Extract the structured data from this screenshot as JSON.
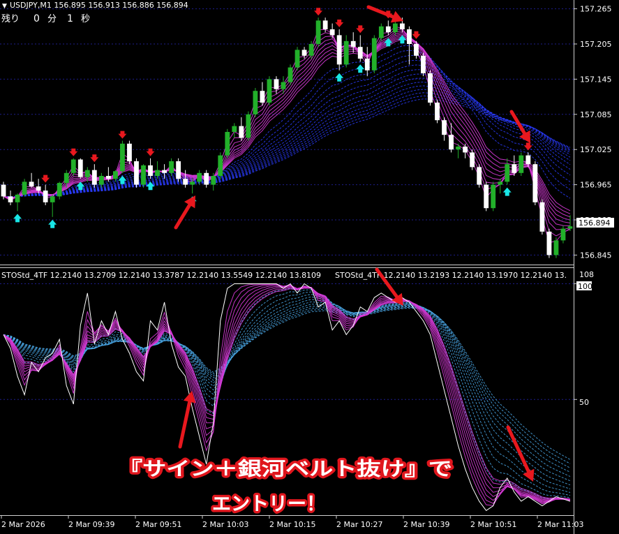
{
  "header": {
    "symbol_line": "USDJPY,M1  156.895 156.913 156.886 156.894",
    "timer_label": "残り",
    "timer_min": "0",
    "timer_min_unit": "分",
    "timer_sec": "1",
    "timer_sec_unit": "秒"
  },
  "indicator": {
    "label_left": "STOStd_4TF 12.2140 13.2709 12.2140 13.3787 12.2140 13.5549 12.2140 13.8109",
    "label_right": "STOStd_4TF 12.2140 13.2193 12.2140 13.1970 12.2140 13.",
    "top_value": "108",
    "level_100": "100",
    "level_50": "50"
  },
  "caption": {
    "line1": "『サイン＋銀河ベルト抜け』で",
    "line2": "エントリー！"
  },
  "colors": {
    "bull": "#22b02a",
    "bear": "#ffffff",
    "ma_belt": "#d83ad8",
    "slow_belt": "#2a3cff",
    "sto_belt": "#4aa8e8",
    "arrow_red": "#e8181e",
    "arrow_cyan": "#19e6e6",
    "grid": "#1e1e8c"
  },
  "chart_data": [
    {
      "type": "candlestick",
      "symbol": "USDJPY",
      "timeframe": "M1",
      "last_price": "156.894",
      "y_ticks": [
        "157.265",
        "157.205",
        "157.145",
        "157.085",
        "157.025",
        "156.965",
        "156.905",
        "156.845"
      ],
      "ylim": [
        156.83,
        157.28
      ],
      "x_ticks": [
        "2 Mar 2026",
        "2 Mar 09:39",
        "2 Mar 09:51",
        "2 Mar 10:03",
        "2 Mar 10:15",
        "2 Mar 10:27",
        "2 Mar 10:39",
        "2 Mar 10:51",
        "2 Mar 11:03"
      ],
      "candles": [
        [
          156.965,
          156.97,
          156.94,
          156.945
        ],
        [
          156.945,
          156.955,
          156.93,
          156.935
        ],
        [
          156.935,
          156.95,
          156.92,
          156.948
        ],
        [
          156.948,
          156.975,
          156.945,
          156.97
        ],
        [
          156.97,
          156.985,
          156.96,
          156.962
        ],
        [
          156.962,
          156.975,
          156.95,
          156.955
        ],
        [
          156.955,
          156.965,
          156.93,
          156.935
        ],
        [
          156.935,
          156.948,
          156.91,
          156.945
        ],
        [
          156.945,
          156.97,
          156.94,
          156.968
        ],
        [
          156.968,
          156.99,
          156.96,
          156.985
        ],
        [
          156.985,
          157.01,
          156.98,
          157.008
        ],
        [
          157.008,
          157.01,
          156.975,
          156.978
        ],
        [
          156.978,
          156.995,
          156.97,
          156.99
        ],
        [
          156.99,
          157.0,
          156.96,
          156.965
        ],
        [
          156.965,
          156.985,
          156.96,
          156.98
        ],
        [
          156.98,
          156.995,
          156.97,
          156.975
        ],
        [
          156.975,
          156.99,
          156.97,
          156.988
        ],
        [
          156.988,
          157.04,
          156.985,
          157.035
        ],
        [
          157.035,
          157.04,
          157.0,
          157.005
        ],
        [
          157.005,
          157.01,
          156.96,
          156.965
        ],
        [
          156.965,
          157.0,
          156.96,
          156.998
        ],
        [
          156.998,
          157.01,
          156.975,
          156.98
        ],
        [
          156.98,
          157.005,
          156.975,
          156.99
        ],
        [
          156.99,
          157.0,
          156.975,
          156.985
        ],
        [
          156.985,
          157.01,
          156.98,
          157.005
        ],
        [
          157.005,
          157.01,
          156.97,
          156.975
        ],
        [
          156.975,
          156.99,
          156.96,
          156.965
        ],
        [
          156.965,
          156.975,
          156.95,
          156.97
        ],
        [
          156.97,
          156.99,
          156.965,
          156.985
        ],
        [
          156.985,
          156.99,
          156.96,
          156.965
        ],
        [
          156.965,
          156.985,
          156.955,
          156.98
        ],
        [
          156.98,
          157.02,
          156.975,
          157.015
        ],
        [
          157.015,
          157.06,
          157.01,
          157.055
        ],
        [
          157.055,
          157.07,
          157.045,
          157.065
        ],
        [
          157.065,
          157.08,
          157.04,
          157.045
        ],
        [
          157.045,
          157.09,
          157.04,
          157.085
        ],
        [
          157.085,
          157.13,
          157.08,
          157.125
        ],
        [
          157.125,
          157.14,
          157.1,
          157.105
        ],
        [
          157.105,
          157.15,
          157.1,
          157.145
        ],
        [
          157.145,
          157.15,
          157.12,
          157.128
        ],
        [
          157.128,
          157.15,
          157.12,
          157.14
        ],
        [
          157.14,
          157.17,
          157.135,
          157.165
        ],
        [
          157.165,
          157.2,
          157.16,
          157.195
        ],
        [
          157.195,
          157.2,
          157.18,
          157.185
        ],
        [
          157.185,
          157.21,
          157.18,
          157.205
        ],
        [
          157.205,
          157.25,
          157.2,
          157.245
        ],
        [
          157.245,
          157.25,
          157.225,
          157.23
        ],
        [
          157.23,
          157.24,
          157.215,
          157.22
        ],
        [
          157.22,
          157.23,
          157.16,
          157.17
        ],
        [
          157.17,
          157.22,
          157.165,
          157.21
        ],
        [
          157.21,
          157.225,
          157.19,
          157.2
        ],
        [
          157.2,
          157.22,
          157.175,
          157.18
        ],
        [
          157.18,
          157.2,
          157.15,
          157.16
        ],
        [
          157.16,
          157.22,
          157.155,
          157.215
        ],
        [
          157.215,
          157.24,
          157.21,
          157.235
        ],
        [
          157.235,
          157.245,
          157.22,
          157.225
        ],
        [
          157.225,
          157.245,
          157.22,
          157.24
        ],
        [
          157.24,
          157.25,
          157.225,
          157.23
        ],
        [
          157.23,
          157.235,
          157.17,
          157.205
        ],
        [
          157.205,
          157.21,
          157.18,
          157.185
        ],
        [
          157.185,
          157.19,
          157.15,
          157.155
        ],
        [
          157.155,
          157.16,
          157.1,
          157.105
        ],
        [
          157.105,
          157.11,
          157.07,
          157.075
        ],
        [
          157.075,
          157.08,
          157.04,
          157.05
        ],
        [
          157.05,
          157.07,
          157.02,
          157.025
        ],
        [
          157.025,
          157.035,
          157.01,
          157.03
        ],
        [
          157.03,
          157.035,
          157.01,
          157.02
        ],
        [
          157.02,
          157.025,
          156.99,
          156.995
        ],
        [
          156.995,
          157.0,
          156.96,
          156.965
        ],
        [
          156.965,
          156.97,
          156.92,
          156.925
        ],
        [
          156.925,
          156.97,
          156.92,
          156.965
        ],
        [
          156.965,
          156.975,
          156.95,
          156.97
        ],
        [
          156.97,
          157.01,
          156.965,
          157.0
        ],
        [
          157.0,
          157.015,
          156.98,
          156.985
        ],
        [
          156.985,
          157.02,
          156.98,
          157.015
        ],
        [
          157.015,
          157.02,
          156.995,
          157.0
        ],
        [
          157.0,
          157.005,
          156.93,
          156.935
        ],
        [
          156.935,
          156.94,
          156.88,
          156.885
        ],
        [
          156.885,
          156.89,
          156.84,
          156.845
        ],
        [
          156.845,
          156.875,
          156.84,
          156.87
        ],
        [
          156.87,
          156.895,
          156.865,
          156.89
        ],
        [
          156.89,
          156.913,
          156.886,
          156.894
        ]
      ]
    },
    {
      "type": "line",
      "name": "STOStd_4TF",
      "y_ticks": [
        "100",
        "50"
      ],
      "ylim": [
        0,
        108
      ],
      "values": [
        78,
        72,
        60,
        52,
        66,
        62,
        68,
        70,
        76,
        56,
        48,
        82,
        96,
        74,
        84,
        78,
        88,
        76,
        70,
        62,
        58,
        84,
        80,
        92,
        74,
        64,
        60,
        46,
        34,
        22,
        40,
        84,
        98,
        100,
        100,
        100,
        100,
        100,
        100,
        100,
        98,
        100,
        96,
        100,
        98,
        90,
        92,
        80,
        84,
        78,
        82,
        90,
        88,
        94,
        96,
        94,
        92,
        94,
        92,
        88,
        84,
        78,
        66,
        54,
        42,
        30,
        20,
        12,
        6,
        2,
        4,
        12,
        16,
        10,
        6,
        8,
        6,
        4,
        6,
        8,
        7,
        6
      ]
    }
  ]
}
